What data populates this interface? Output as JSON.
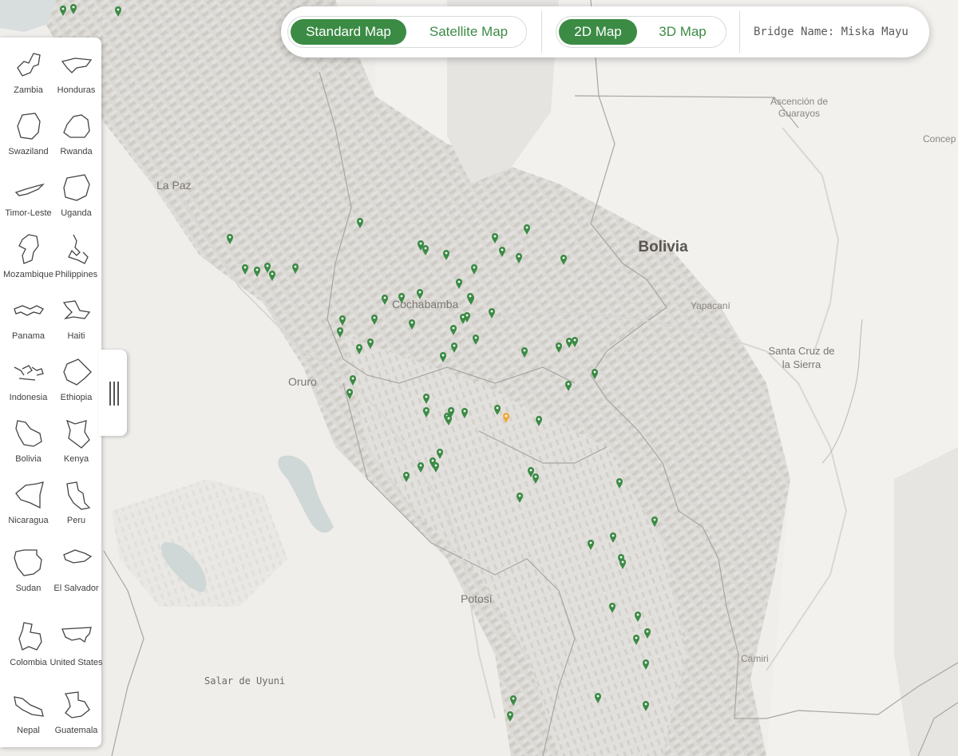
{
  "toolbar": {
    "map_type": {
      "standard": "Standard Map",
      "satellite": "Satellite Map",
      "selected": "Standard Map"
    },
    "view_mode": {
      "two_d": "2D Map",
      "three_d": "3D Map",
      "selected": "2D Map"
    },
    "bridge_name": "Bridge Name: Miska Mayu"
  },
  "countries": [
    {
      "name": "Zambia"
    },
    {
      "name": "Honduras"
    },
    {
      "name": "Swaziland"
    },
    {
      "name": "Rwanda"
    },
    {
      "name": "Timor-Leste"
    },
    {
      "name": "Uganda"
    },
    {
      "name": "Mozambique"
    },
    {
      "name": "Philippines"
    },
    {
      "name": "Panama"
    },
    {
      "name": "Haiti"
    },
    {
      "name": "Indonesia"
    },
    {
      "name": "Ethiopia"
    },
    {
      "name": "Bolivia"
    },
    {
      "name": "Kenya"
    },
    {
      "name": "Nicaragua"
    },
    {
      "name": "Peru"
    },
    {
      "name": "Sudan"
    },
    {
      "name": "El Salvador"
    },
    {
      "name": "Colombia"
    },
    {
      "name": "United States"
    },
    {
      "name": "Nepal"
    },
    {
      "name": "Guatemala"
    }
  ],
  "map_labels": {
    "country": "Bolivia",
    "la_paz": "La Paz",
    "cochabamba": "Cochabamba",
    "oruro": "Oruro",
    "potosi": "Potosí",
    "salar": "Salar de Uyuni",
    "camiri": "Camiri",
    "yapacani": "Yapacaní",
    "santa_cruz": "Santa Cruz de la Sierra",
    "ascencion": "Ascención de Guarayos",
    "concepcion": "Concep"
  },
  "colors": {
    "pin": "#3b8b45",
    "selected_pin": "#f2a93b",
    "accent": "#3b8b45"
  }
}
